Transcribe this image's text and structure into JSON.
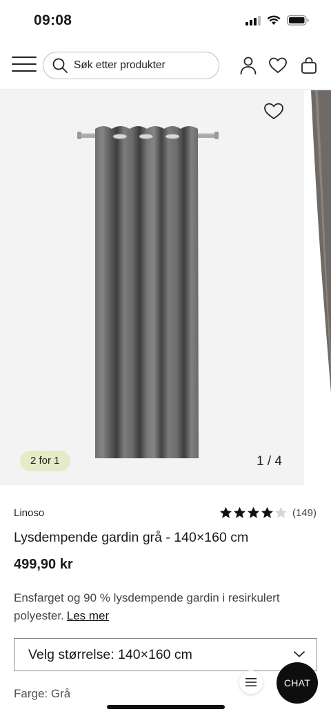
{
  "status_bar": {
    "time": "09:08"
  },
  "header": {
    "search_placeholder": "Søk etter produkter"
  },
  "gallery": {
    "badge": "2 for 1",
    "counter": "1 / 4"
  },
  "product": {
    "brand": "Linoso",
    "rating_stars": 4,
    "rating_max": 5,
    "review_count": "(149)",
    "title": "Lysdempende gardin grå - 140×160 cm",
    "price": "499,90 kr",
    "description": "Ensfarget og 90 % lysdempende gardin i resirkulert polyester.",
    "read_more": "Les mer",
    "size_select": "Velg størrelse: 140×160 cm",
    "color_label": "Farge:",
    "color_value": "Grå"
  },
  "chat": {
    "label": "CHAT"
  }
}
